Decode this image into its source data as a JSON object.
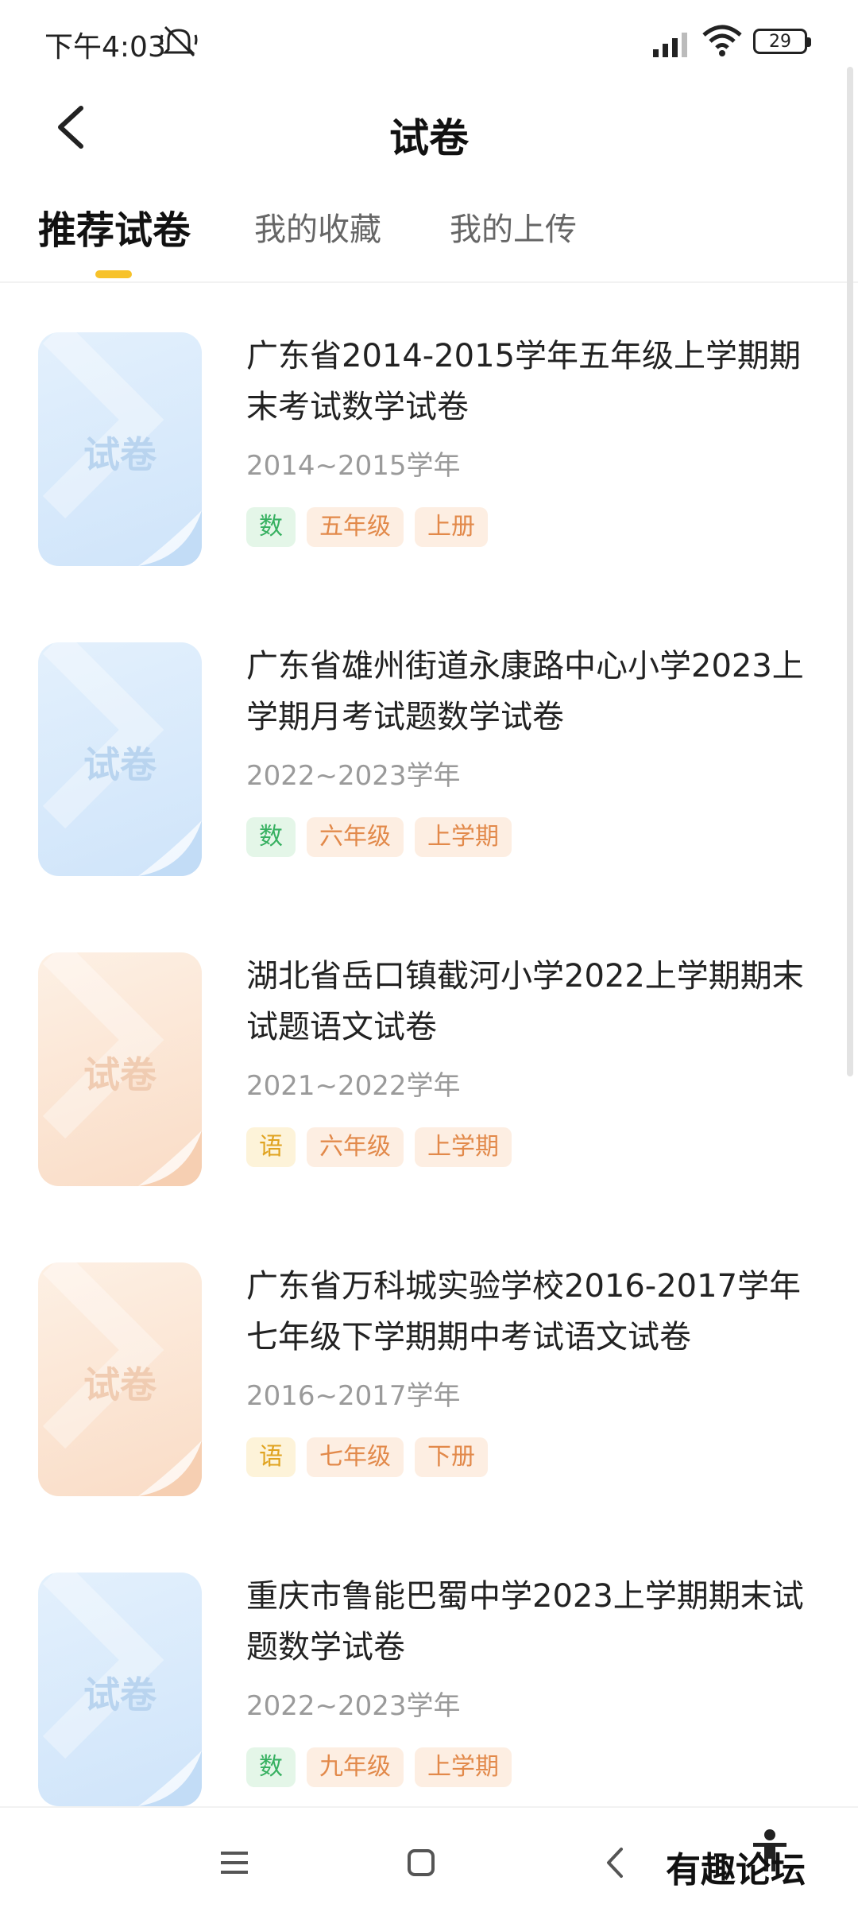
{
  "status_bar": {
    "time": "下午4:03",
    "battery": "29"
  },
  "header": {
    "title": "试卷"
  },
  "tabs": [
    {
      "label": "推荐试卷",
      "active": true
    },
    {
      "label": "我的收藏",
      "active": false
    },
    {
      "label": "我的上传",
      "active": false
    }
  ],
  "papers": [
    {
      "title": "广东省2014-2015学年五年级上学期期末考试数学试卷",
      "year": "2014~2015学年",
      "thumb_label": "试卷",
      "thumb_color": "blue",
      "subject": "数",
      "subject_type": "math",
      "grade": "五年级",
      "term": "上册"
    },
    {
      "title": "广东省雄州街道永康路中心小学2023上学期月考试题数学试卷",
      "year": "2022~2023学年",
      "thumb_label": "试卷",
      "thumb_color": "blue",
      "subject": "数",
      "subject_type": "math",
      "grade": "六年级",
      "term": "上学期"
    },
    {
      "title": "湖北省岳口镇截河小学2022上学期期末试题语文试卷",
      "year": "2021~2022学年",
      "thumb_label": "试卷",
      "thumb_color": "orange",
      "subject": "语",
      "subject_type": "chinese",
      "grade": "六年级",
      "term": "上学期"
    },
    {
      "title": "广东省万科城实验学校2016-2017学年七年级下学期期中考试语文试卷",
      "year": "2016~2017学年",
      "thumb_label": "试卷",
      "thumb_color": "orange",
      "subject": "语",
      "subject_type": "chinese",
      "grade": "七年级",
      "term": "下册"
    },
    {
      "title": "重庆市鲁能巴蜀中学2023上学期期末试题数学试卷",
      "year": "2022~2023学年",
      "thumb_label": "试卷",
      "thumb_color": "blue",
      "subject": "数",
      "subject_type": "math",
      "grade": "九年级",
      "term": "上学期"
    }
  ],
  "watermark": "有趣论坛",
  "colors": {
    "accent": "#f7c22a",
    "math_tag": "#36b060",
    "chinese_tag": "#e0a320",
    "meta_tag": "#e2894a"
  }
}
